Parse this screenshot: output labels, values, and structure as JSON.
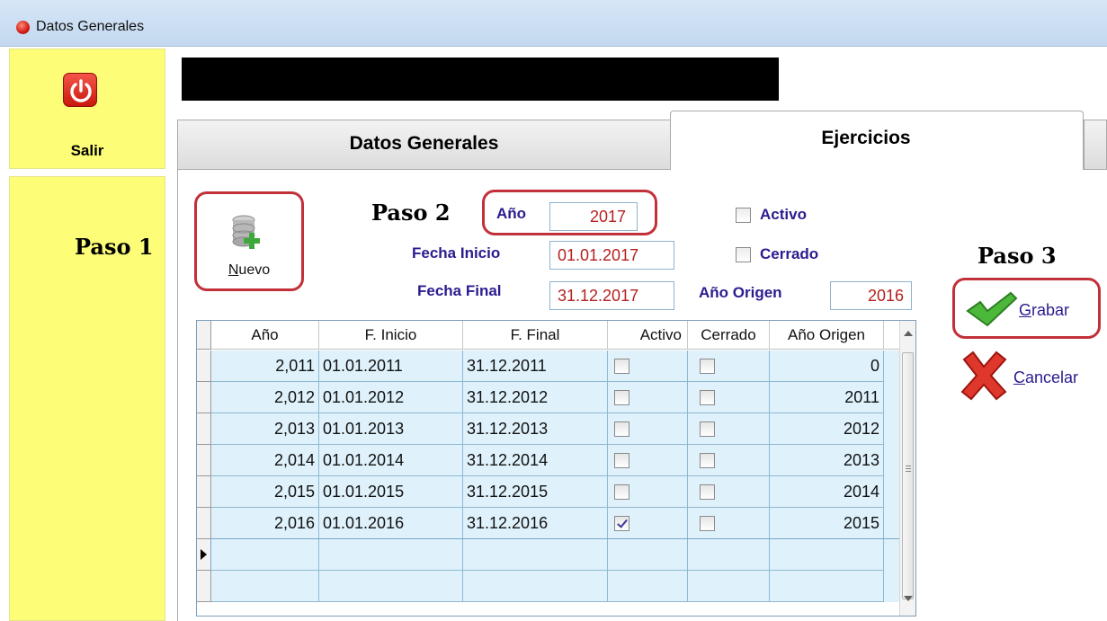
{
  "window": {
    "title": "Datos Generales"
  },
  "sidebar": {
    "exit_label": "Salir"
  },
  "steps": {
    "step1": "Paso 1",
    "step2": "Paso 2",
    "step3": "Paso 3"
  },
  "tabs": [
    {
      "label": "Datos Generales"
    },
    {
      "label": "Ejercicios"
    }
  ],
  "toolbar": {
    "new_prefix": "N",
    "new_rest": "uevo"
  },
  "form": {
    "year_label": "Año",
    "year_value": "2017",
    "start_label": "Fecha Inicio",
    "start_value": "01.01.2017",
    "end_label": "Fecha Final",
    "end_value": "31.12.2017",
    "origin_label": "Año Origen",
    "origin_value": "2016",
    "active_label": "Activo",
    "closed_label": "Cerrado"
  },
  "grid": {
    "columns": [
      "Año",
      "F. Inicio",
      "F. Final",
      "Activo",
      "Cerrado",
      "Año Origen"
    ],
    "rows": [
      {
        "year": "2,011",
        "start": "01.01.2011",
        "end": "31.12.2011",
        "active": false,
        "closed": false,
        "origin": "0"
      },
      {
        "year": "2,012",
        "start": "01.01.2012",
        "end": "31.12.2012",
        "active": false,
        "closed": false,
        "origin": "2011"
      },
      {
        "year": "2,013",
        "start": "01.01.2013",
        "end": "31.12.2013",
        "active": false,
        "closed": false,
        "origin": "2012"
      },
      {
        "year": "2,014",
        "start": "01.01.2014",
        "end": "31.12.2014",
        "active": false,
        "closed": false,
        "origin": "2013"
      },
      {
        "year": "2,015",
        "start": "01.01.2015",
        "end": "31.12.2015",
        "active": false,
        "closed": false,
        "origin": "2014"
      },
      {
        "year": "2,016",
        "start": "01.01.2016",
        "end": "31.12.2016",
        "active": true,
        "closed": false,
        "origin": "2015"
      }
    ]
  },
  "actions": {
    "save_prefix": "G",
    "save_rest": "rabar",
    "cancel_prefix": "C",
    "cancel_rest": "ancelar"
  },
  "colors": {
    "sidebar": "#fdfd78",
    "highlight": "#c2303a",
    "label": "#2a1c8f",
    "value": "#b52020",
    "row": "#dff2fc"
  }
}
